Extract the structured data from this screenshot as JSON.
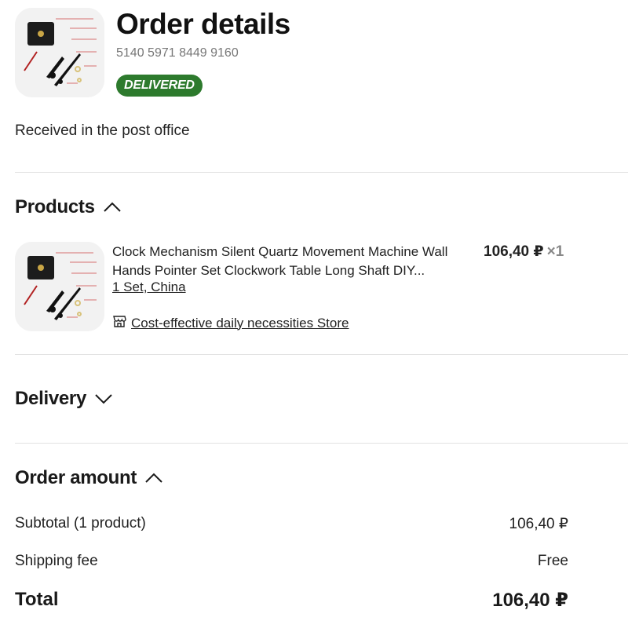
{
  "header": {
    "title": "Order details",
    "order_number": "5140 5971 8449 9160",
    "status_badge": "DELIVERED",
    "status_badge_color": "#2d7a2d"
  },
  "status_message": "Received in the post office",
  "products_section": {
    "title": "Products",
    "expanded": true,
    "items": [
      {
        "title": "Clock Mechanism Silent Quartz Movement Machine Wall Hands Pointer Set Clockwork Table Long Shaft DIY...",
        "variant": "1 Set, China",
        "price": "106,40 ₽",
        "quantity": "×1",
        "store_icon": "store-icon",
        "store_name": "Cost-effective daily necessities Store"
      }
    ]
  },
  "delivery_section": {
    "title": "Delivery",
    "expanded": false
  },
  "order_amount_section": {
    "title": "Order amount",
    "expanded": true,
    "subtotal_label": "Subtotal (1 product)",
    "subtotal_value": "106,40 ₽",
    "shipping_label": "Shipping fee",
    "shipping_value": "Free",
    "total_label": "Total",
    "total_value": "106,40 ₽"
  }
}
